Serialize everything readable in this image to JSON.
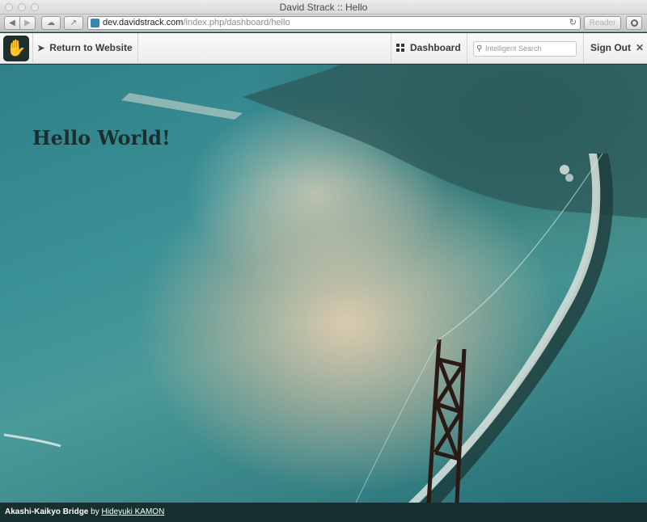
{
  "browser": {
    "window_title": "David Strack :: Hello",
    "url_host": "dev.davidstrack.com",
    "url_path": "/index.php/dashboard/hello",
    "reader_label": "Reader"
  },
  "toolbar": {
    "return_label": "Return to Website",
    "dashboard_label": "Dashboard",
    "search_placeholder": "Intelligent Search",
    "signout_label": "Sign Out"
  },
  "page": {
    "heading": "Hello World!"
  },
  "caption": {
    "title": "Akashi-Kaikyo Bridge",
    "by": "by",
    "author": "Hideyuki KAMON"
  }
}
